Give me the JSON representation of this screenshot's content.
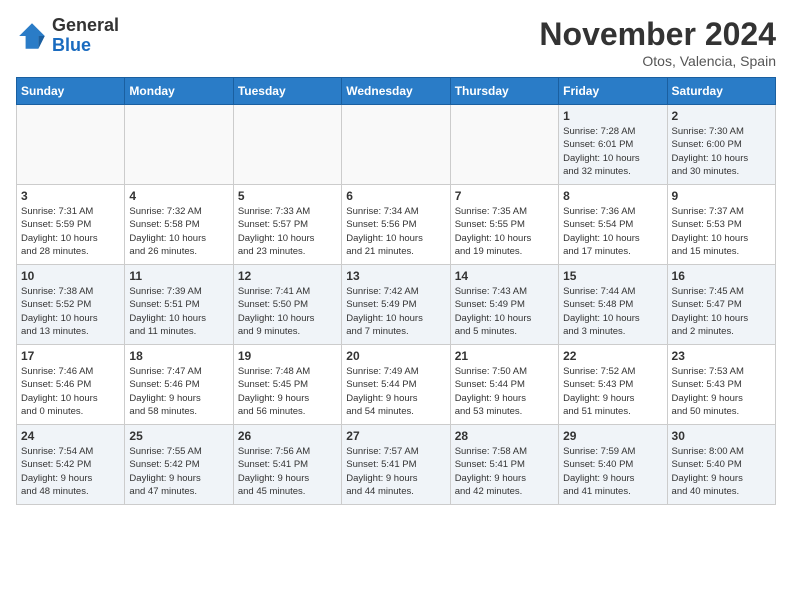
{
  "header": {
    "logo_line1": "General",
    "logo_line2": "Blue",
    "month": "November 2024",
    "location": "Otos, Valencia, Spain"
  },
  "weekdays": [
    "Sunday",
    "Monday",
    "Tuesday",
    "Wednesday",
    "Thursday",
    "Friday",
    "Saturday"
  ],
  "weeks": [
    [
      {
        "day": "",
        "info": ""
      },
      {
        "day": "",
        "info": ""
      },
      {
        "day": "",
        "info": ""
      },
      {
        "day": "",
        "info": ""
      },
      {
        "day": "",
        "info": ""
      },
      {
        "day": "1",
        "info": "Sunrise: 7:28 AM\nSunset: 6:01 PM\nDaylight: 10 hours\nand 32 minutes."
      },
      {
        "day": "2",
        "info": "Sunrise: 7:30 AM\nSunset: 6:00 PM\nDaylight: 10 hours\nand 30 minutes."
      }
    ],
    [
      {
        "day": "3",
        "info": "Sunrise: 7:31 AM\nSunset: 5:59 PM\nDaylight: 10 hours\nand 28 minutes."
      },
      {
        "day": "4",
        "info": "Sunrise: 7:32 AM\nSunset: 5:58 PM\nDaylight: 10 hours\nand 26 minutes."
      },
      {
        "day": "5",
        "info": "Sunrise: 7:33 AM\nSunset: 5:57 PM\nDaylight: 10 hours\nand 23 minutes."
      },
      {
        "day": "6",
        "info": "Sunrise: 7:34 AM\nSunset: 5:56 PM\nDaylight: 10 hours\nand 21 minutes."
      },
      {
        "day": "7",
        "info": "Sunrise: 7:35 AM\nSunset: 5:55 PM\nDaylight: 10 hours\nand 19 minutes."
      },
      {
        "day": "8",
        "info": "Sunrise: 7:36 AM\nSunset: 5:54 PM\nDaylight: 10 hours\nand 17 minutes."
      },
      {
        "day": "9",
        "info": "Sunrise: 7:37 AM\nSunset: 5:53 PM\nDaylight: 10 hours\nand 15 minutes."
      }
    ],
    [
      {
        "day": "10",
        "info": "Sunrise: 7:38 AM\nSunset: 5:52 PM\nDaylight: 10 hours\nand 13 minutes."
      },
      {
        "day": "11",
        "info": "Sunrise: 7:39 AM\nSunset: 5:51 PM\nDaylight: 10 hours\nand 11 minutes."
      },
      {
        "day": "12",
        "info": "Sunrise: 7:41 AM\nSunset: 5:50 PM\nDaylight: 10 hours\nand 9 minutes."
      },
      {
        "day": "13",
        "info": "Sunrise: 7:42 AM\nSunset: 5:49 PM\nDaylight: 10 hours\nand 7 minutes."
      },
      {
        "day": "14",
        "info": "Sunrise: 7:43 AM\nSunset: 5:49 PM\nDaylight: 10 hours\nand 5 minutes."
      },
      {
        "day": "15",
        "info": "Sunrise: 7:44 AM\nSunset: 5:48 PM\nDaylight: 10 hours\nand 3 minutes."
      },
      {
        "day": "16",
        "info": "Sunrise: 7:45 AM\nSunset: 5:47 PM\nDaylight: 10 hours\nand 2 minutes."
      }
    ],
    [
      {
        "day": "17",
        "info": "Sunrise: 7:46 AM\nSunset: 5:46 PM\nDaylight: 10 hours\nand 0 minutes."
      },
      {
        "day": "18",
        "info": "Sunrise: 7:47 AM\nSunset: 5:46 PM\nDaylight: 9 hours\nand 58 minutes."
      },
      {
        "day": "19",
        "info": "Sunrise: 7:48 AM\nSunset: 5:45 PM\nDaylight: 9 hours\nand 56 minutes."
      },
      {
        "day": "20",
        "info": "Sunrise: 7:49 AM\nSunset: 5:44 PM\nDaylight: 9 hours\nand 54 minutes."
      },
      {
        "day": "21",
        "info": "Sunrise: 7:50 AM\nSunset: 5:44 PM\nDaylight: 9 hours\nand 53 minutes."
      },
      {
        "day": "22",
        "info": "Sunrise: 7:52 AM\nSunset: 5:43 PM\nDaylight: 9 hours\nand 51 minutes."
      },
      {
        "day": "23",
        "info": "Sunrise: 7:53 AM\nSunset: 5:43 PM\nDaylight: 9 hours\nand 50 minutes."
      }
    ],
    [
      {
        "day": "24",
        "info": "Sunrise: 7:54 AM\nSunset: 5:42 PM\nDaylight: 9 hours\nand 48 minutes."
      },
      {
        "day": "25",
        "info": "Sunrise: 7:55 AM\nSunset: 5:42 PM\nDaylight: 9 hours\nand 47 minutes."
      },
      {
        "day": "26",
        "info": "Sunrise: 7:56 AM\nSunset: 5:41 PM\nDaylight: 9 hours\nand 45 minutes."
      },
      {
        "day": "27",
        "info": "Sunrise: 7:57 AM\nSunset: 5:41 PM\nDaylight: 9 hours\nand 44 minutes."
      },
      {
        "day": "28",
        "info": "Sunrise: 7:58 AM\nSunset: 5:41 PM\nDaylight: 9 hours\nand 42 minutes."
      },
      {
        "day": "29",
        "info": "Sunrise: 7:59 AM\nSunset: 5:40 PM\nDaylight: 9 hours\nand 41 minutes."
      },
      {
        "day": "30",
        "info": "Sunrise: 8:00 AM\nSunset: 5:40 PM\nDaylight: 9 hours\nand 40 minutes."
      }
    ]
  ]
}
